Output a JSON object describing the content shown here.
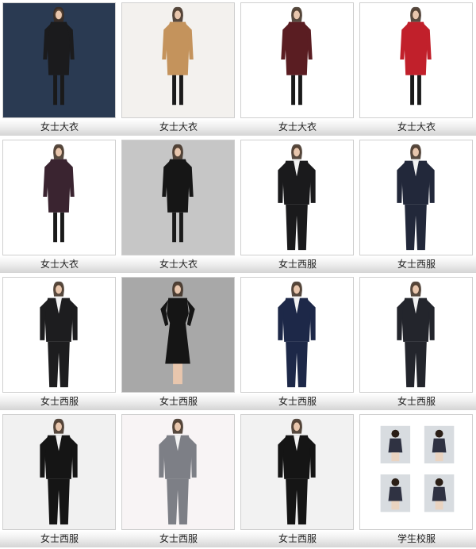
{
  "items": [
    {
      "caption": "女士大衣",
      "bg": "#2a3a52",
      "garment": "#1b1b1d",
      "style": "coat"
    },
    {
      "caption": "女士大衣",
      "bg": "#f3f1ee",
      "garment": "#c4935c",
      "style": "coat"
    },
    {
      "caption": "女士大衣",
      "bg": "#ffffff",
      "garment": "#5a1d22",
      "style": "coat"
    },
    {
      "caption": "女士大衣",
      "bg": "#ffffff",
      "garment": "#c1202b",
      "style": "coat"
    },
    {
      "caption": "女士大衣",
      "bg": "#ffffff",
      "garment": "#3a2430",
      "style": "coat"
    },
    {
      "caption": "女士大衣",
      "bg": "#c6c6c6",
      "garment": "#161616",
      "style": "coat"
    },
    {
      "caption": "女士西服",
      "bg": "#ffffff",
      "garment": "#1a1a1c",
      "style": "suit"
    },
    {
      "caption": "女士西服",
      "bg": "#ffffff",
      "garment": "#22283a",
      "style": "suit"
    },
    {
      "caption": "女士西服",
      "bg": "#ffffff",
      "garment": "#1d1d1f",
      "style": "suit"
    },
    {
      "caption": "女士西服",
      "bg": "#a8a8a8",
      "garment": "#151515",
      "style": "dress"
    },
    {
      "caption": "女士西服",
      "bg": "#ffffff",
      "garment": "#1d2848",
      "style": "suit"
    },
    {
      "caption": "女士西服",
      "bg": "#ffffff",
      "garment": "#23252c",
      "style": "suit"
    },
    {
      "caption": "女士西服",
      "bg": "#f1f1f1",
      "garment": "#151515",
      "style": "suit"
    },
    {
      "caption": "女士西服",
      "bg": "#f8f4f5",
      "garment": "#7d7f86",
      "style": "suit"
    },
    {
      "caption": "女士西服",
      "bg": "#f2f2f2",
      "garment": "#151515",
      "style": "suit"
    },
    {
      "caption": "学生校服",
      "bg": "#ffffff",
      "garment": "#2f3242",
      "style": "kids"
    }
  ]
}
